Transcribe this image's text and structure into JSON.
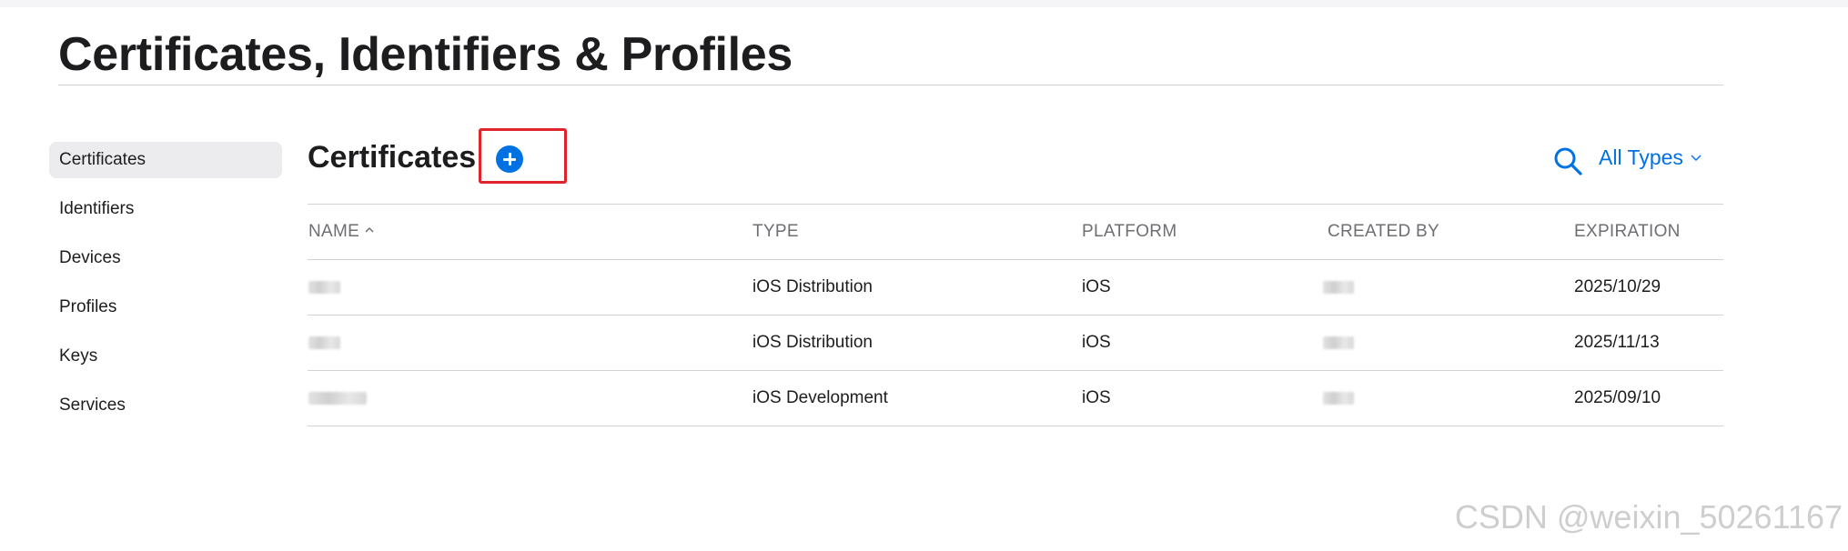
{
  "page": {
    "title": "Certificates, Identifiers & Profiles"
  },
  "sidebar": {
    "items": [
      {
        "label": "Certificates",
        "active": true
      },
      {
        "label": "Identifiers"
      },
      {
        "label": "Devices"
      },
      {
        "label": "Profiles"
      },
      {
        "label": "Keys"
      },
      {
        "label": "Services"
      }
    ]
  },
  "section": {
    "title": "Certificates",
    "add_icon": "plus-circle-icon",
    "search_icon": "search-icon",
    "filter_label": "All Types",
    "filter_icon": "chevron-down-icon"
  },
  "table": {
    "columns": [
      "NAME",
      "TYPE",
      "PLATFORM",
      "CREATED BY",
      "EXPIRATION"
    ],
    "sort_icon": "chevron-up-icon",
    "rows": [
      {
        "name": "",
        "type": "iOS Distribution",
        "platform": "iOS",
        "created_by": "",
        "expiration": "2025/10/29"
      },
      {
        "name": "",
        "type": "iOS Distribution",
        "platform": "iOS",
        "created_by": "",
        "expiration": "2025/11/13"
      },
      {
        "name": "",
        "type": "iOS Development",
        "platform": "iOS",
        "created_by": "",
        "expiration": "2025/09/10"
      }
    ]
  },
  "colors": {
    "accent": "#0071e3",
    "highlight": "#e0242b",
    "active_bg": "#ececee"
  },
  "watermark": "CSDN @weixin_50261167"
}
